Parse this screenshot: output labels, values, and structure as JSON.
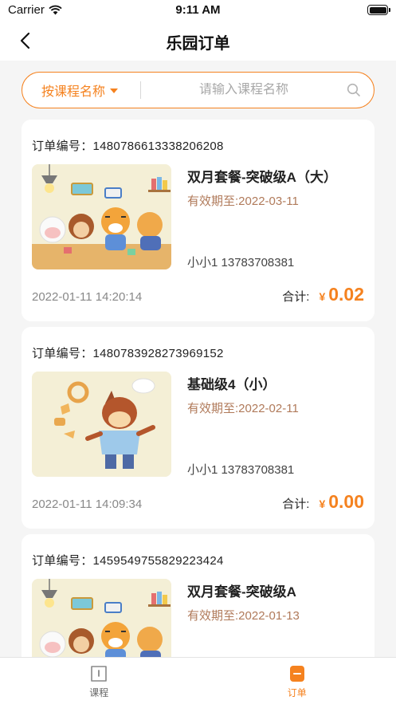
{
  "status_bar": {
    "carrier": "Carrier",
    "time": "9:11 AM"
  },
  "nav": {
    "title": "乐园订单"
  },
  "search": {
    "filter_label": "按课程名称",
    "placeholder": "请输入课程名称"
  },
  "orders": [
    {
      "order_no_label": "订单编号：1480786613338206208",
      "course": "双月套餐-突破级A（大）",
      "valid_until": "有效期至:2022-03-11",
      "student": "小小1   13783708381",
      "created": "2022-01-11 14:20:14",
      "total_label": "合计:",
      "currency": "¥",
      "amount": "0.02",
      "image": "classroom-cartoon-animals"
    },
    {
      "order_no_label": "订单编号：1480783928273969152",
      "course": "基础级4（小）",
      "valid_until": "有效期至:2022-02-11",
      "student": "小小1   13783708381",
      "created": "2022-01-11 14:09:34",
      "total_label": "合计:",
      "currency": "¥",
      "amount": "0.00",
      "image": "cartoon-horse-chef"
    },
    {
      "order_no_label": "订单编号：1459549755829223424",
      "course": "双月套餐-突破级A",
      "valid_until": "有效期至:2022-01-13",
      "student": "",
      "created": "",
      "total_label": "",
      "currency": "",
      "amount": "",
      "image": "classroom-cartoon-animals"
    }
  ],
  "tabbar": {
    "courses": "课程",
    "orders": "订单"
  },
  "colors": {
    "accent": "#f5821f",
    "valid_text": "#b07a5a"
  }
}
